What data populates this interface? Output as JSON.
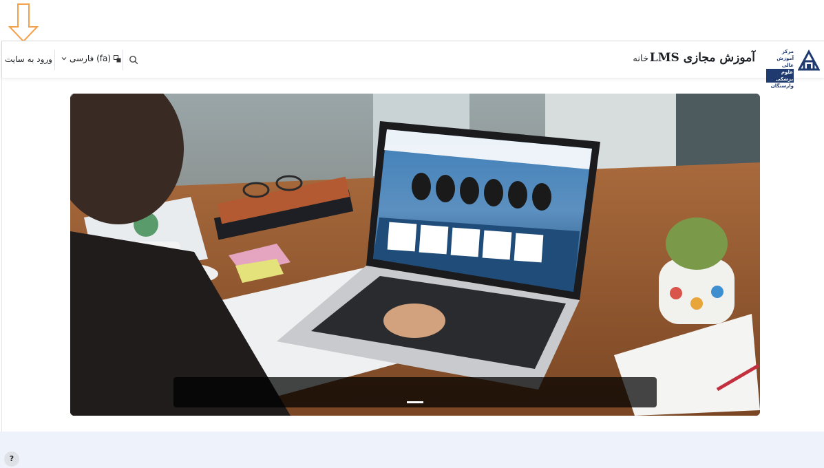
{
  "header": {
    "logo_line1": "مرکز آموزش عالی",
    "logo_line2": "علوم پزشکی",
    "logo_line3": "وارستگان",
    "site_name": "آموزش مجازی LMS",
    "nav_home": "خانه",
    "language_label": "فارسی (fa)",
    "login_label": "ورود به سایت"
  },
  "icons": {
    "annotation": "down-arrow-icon",
    "search": "search-icon",
    "language": "language-icon",
    "chevron": "chevron-down-icon",
    "help": "question-icon"
  },
  "footer": {
    "help_label": "?"
  },
  "colors": {
    "brand_navy": "#1e3a6e",
    "annotation_orange": "#f5a04a",
    "footer_bg": "#eef3fb"
  }
}
